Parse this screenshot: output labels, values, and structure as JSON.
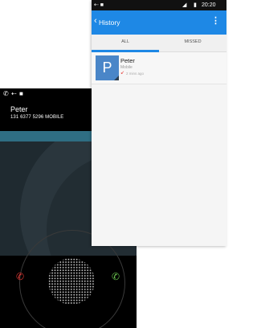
{
  "call": {
    "caller_name": "Peter",
    "caller_number": "131 6377 5296 MOBILE",
    "icons": {
      "status_phone": "phone-icon",
      "status_wifi": "arrow-icon",
      "decline": "decline-call-icon",
      "answer": "answer-call-icon"
    },
    "colors": {
      "decline": "#e53935",
      "answer": "#6ac44f",
      "band": "#2f6e83"
    }
  },
  "history": {
    "status_time": "20:20",
    "title": "History",
    "tabs": [
      "ALL",
      "MISSED"
    ],
    "active_tab": "ALL",
    "entries": [
      {
        "initial": "P",
        "name": "Peter",
        "type": "Mobile",
        "time": "2 mins ago",
        "call_icon": "missed-call-icon"
      }
    ],
    "colors": {
      "accent": "#1e88e5",
      "avatar": "#4a86c8",
      "missed": "#e53935"
    }
  }
}
